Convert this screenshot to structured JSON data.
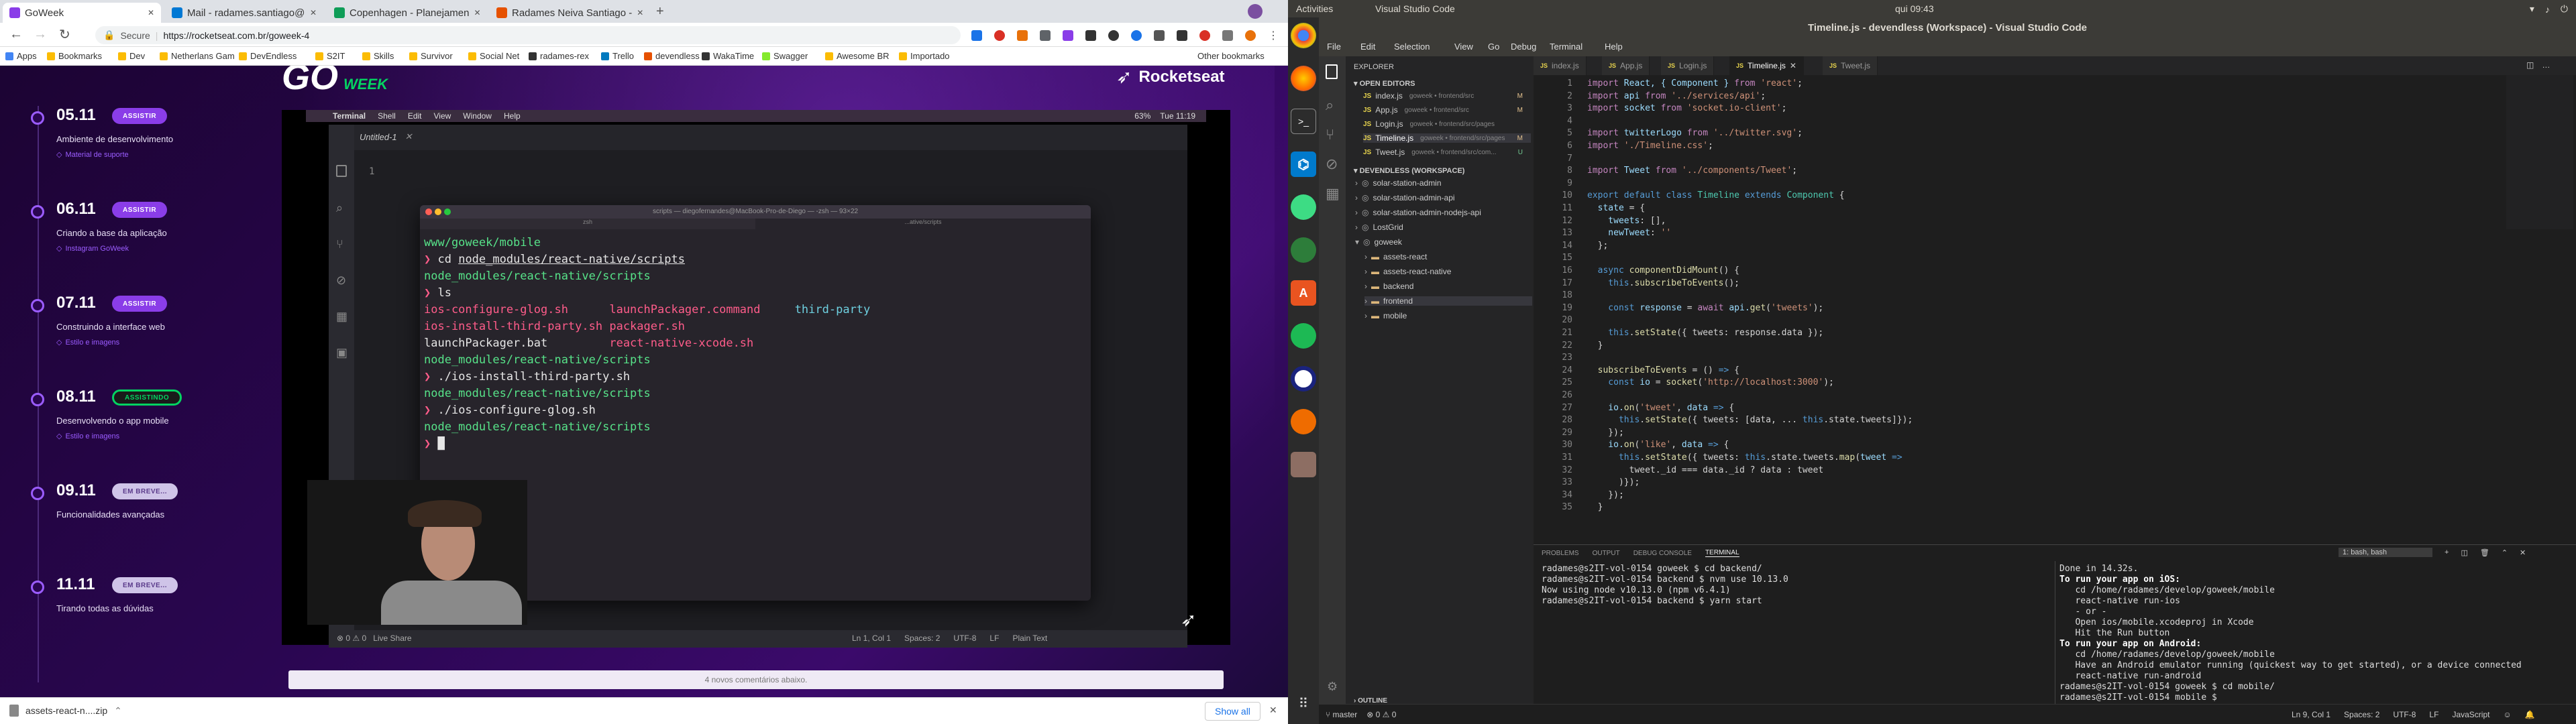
{
  "browser": {
    "tabs": [
      {
        "title": "GoWeek",
        "color": "#8a3de8",
        "active": true
      },
      {
        "title": "Mail - radames.santiago@",
        "color": "#0078d4"
      },
      {
        "title": "Copenhagen - Planejamen",
        "color": "#0f9d58"
      },
      {
        "title": "Radames Neiva Santiago -",
        "color": "#e65100"
      }
    ],
    "secure_label": "Secure",
    "url": "https://rocketseat.com.br/goweek-4",
    "bookmarks": [
      {
        "label": "Apps",
        "color": "#4285f4"
      },
      {
        "label": "Bookmarks",
        "color": "#fbbc04"
      },
      {
        "label": "Dev",
        "color": "#fbbc04"
      },
      {
        "label": "Netherlans Gam",
        "color": "#fbbc04"
      },
      {
        "label": "DevEndless",
        "color": "#fbbc04"
      },
      {
        "label": "S2IT",
        "color": "#fbbc04"
      },
      {
        "label": "Skills",
        "color": "#fbbc04"
      },
      {
        "label": "Survivor",
        "color": "#fbbc04"
      },
      {
        "label": "Social Net",
        "color": "#fbbc04"
      },
      {
        "label": "radames-rex",
        "color": "#333"
      },
      {
        "label": "Trello",
        "color": "#0079bf"
      },
      {
        "label": "devendless",
        "color": "#e65100"
      },
      {
        "label": "WakaTime",
        "color": "#333"
      },
      {
        "label": "Swagger",
        "color": "#85ea2d"
      },
      {
        "label": "Awesome BR",
        "color": "#fbbc04"
      },
      {
        "label": "Importado",
        "color": "#fbbc04"
      }
    ],
    "other_bookmarks": "Other bookmarks",
    "download_file": "assets-react-n....zip",
    "show_all": "Show all"
  },
  "page": {
    "logo": "GO",
    "logo_sub": "WEEK",
    "brand": "Rocketseat",
    "timeline": [
      {
        "date": "05.11",
        "status": "ASSISTIR",
        "kind": "watch",
        "desc": "Ambiente de desenvolvimento",
        "link": "Material de suporte"
      },
      {
        "date": "06.11",
        "status": "ASSISTIR",
        "kind": "watch",
        "desc": "Criando a base da aplicação",
        "link": "Instagram GoWeek"
      },
      {
        "date": "07.11",
        "status": "ASSISTIR",
        "kind": "watch",
        "desc": "Construindo a interface web",
        "link": "Estilo e imagens"
      },
      {
        "date": "08.11",
        "status": "ASSISTINDO",
        "kind": "live",
        "desc": "Desenvolvendo o app mobile",
        "link": "Estilo e imagens"
      },
      {
        "date": "09.11",
        "status": "EM BREVE...",
        "kind": "soon",
        "desc": "Funcionalidades avançadas",
        "link": ""
      },
      {
        "date": "11.11",
        "status": "EM BREVE...",
        "kind": "soon",
        "desc": "Tirando todas as dúvidas",
        "link": ""
      }
    ],
    "comments": "4 novos comentários abaixo."
  },
  "video": {
    "menubar": [
      "Terminal",
      "Shell",
      "Edit",
      "View",
      "Window",
      "Help"
    ],
    "mac_clock": "Tue 11:19",
    "mac_battery": "63%",
    "editor_tab": "Untitled-1",
    "line_no": "1",
    "term_title": "scripts — diegofernandes@MacBook-Pro-de-Diego — -zsh — 93×22",
    "term_tab1": "zsh",
    "term_tab2": "...ative/scripts",
    "terminal_lines": [
      [
        {
          "t": "www/goweek/mobile",
          "c": "tg"
        }
      ],
      [
        {
          "t": "❯ ",
          "c": "tp"
        },
        {
          "t": "cd ",
          "c": ""
        },
        {
          "t": "node_modules/react-native/scripts",
          "c": "u"
        }
      ],
      [
        {
          "t": "node_modules/react-native/scripts",
          "c": "tg"
        }
      ],
      [
        {
          "t": "❯ ",
          "c": "tp"
        },
        {
          "t": "ls",
          "c": ""
        }
      ],
      [
        {
          "t": "ios-configure-glog.sh      ",
          "c": "tp"
        },
        {
          "t": "launchPackager.command     ",
          "c": "tp"
        },
        {
          "t": "third-party",
          "c": "tc"
        }
      ],
      [
        {
          "t": "ios-install-third-party.sh ",
          "c": "tp"
        },
        {
          "t": "packager.sh",
          "c": "tp"
        }
      ],
      [
        {
          "t": "launchPackager.bat         ",
          "c": ""
        },
        {
          "t": "react-native-xcode.sh",
          "c": "tp"
        }
      ],
      [
        {
          "t": "node_modules/react-native/scripts",
          "c": "tg"
        }
      ],
      [
        {
          "t": "❯ ",
          "c": "tp"
        },
        {
          "t": "./ios-install-third-party.sh",
          "c": ""
        }
      ],
      [
        {
          "t": "node_modules/react-native/scripts",
          "c": "tg"
        }
      ],
      [
        {
          "t": "❯ ",
          "c": "tp"
        },
        {
          "t": "./ios-configure-glog.sh",
          "c": ""
        }
      ],
      [
        {
          "t": "node_modules/react-native/scripts",
          "c": "tg"
        }
      ],
      [
        {
          "t": "❯ ",
          "c": "tp"
        },
        {
          "t": "█",
          "c": ""
        }
      ]
    ],
    "mac_status": {
      "problems": "0",
      "warnings": "0",
      "live": "Live Share",
      "pos": "Ln 1, Col 1",
      "spaces": "Spaces: 2",
      "enc": "UTF-8",
      "eol": "LF",
      "lang": "Plain Text"
    }
  },
  "ubuntu": {
    "activities": "Activities",
    "app": "Visual Studio Code",
    "clock": "qui 09:43"
  },
  "vscode": {
    "title": "Timeline.js - devendless (Workspace) - Visual Studio Code",
    "menu": [
      "File",
      "Edit",
      "Selection",
      "View",
      "Go",
      "Debug",
      "Terminal",
      "Help"
    ],
    "explorer": "EXPLORER",
    "open_editors": "OPEN EDITORS",
    "open_files": [
      {
        "name": "index.js",
        "path": "goweek • frontend/src",
        "mod": "M"
      },
      {
        "name": "App.js",
        "path": "goweek • frontend/src",
        "mod": "M"
      },
      {
        "name": "Login.js",
        "path": "goweek • frontend/src/pages",
        "mod": ""
      },
      {
        "name": "Timeline.js",
        "path": "goweek • frontend/src/pages",
        "mod": "M"
      },
      {
        "name": "Tweet.js",
        "path": "goweek • frontend/src/com...",
        "mod": "U"
      }
    ],
    "workspace": "DEVENDLESS (WORKSPACE)",
    "folders": [
      "solar-station-admin",
      "solar-station-admin-api",
      "solar-station-admin-nodejs-api",
      "LostGrid",
      "goweek",
      "assets-react",
      "assets-react-native",
      "backend",
      "frontend",
      "mobile"
    ],
    "tabs": [
      "index.js",
      "App.js",
      "Login.js",
      "Timeline.js",
      "Tweet.js"
    ],
    "active_tab": "Timeline.js",
    "code": [
      [
        {
          "t": "import ",
          "c": "kw"
        },
        {
          "t": "React, { Component } ",
          "c": "v"
        },
        {
          "t": "from ",
          "c": "kw"
        },
        {
          "t": "'react'",
          "c": "s"
        },
        {
          "t": ";",
          "c": ""
        }
      ],
      [
        {
          "t": "import ",
          "c": "kw"
        },
        {
          "t": "api ",
          "c": "v"
        },
        {
          "t": "from ",
          "c": "kw"
        },
        {
          "t": "'../services/api'",
          "c": "s"
        },
        {
          "t": ";",
          "c": ""
        }
      ],
      [
        {
          "t": "import ",
          "c": "kw"
        },
        {
          "t": "socket ",
          "c": "v"
        },
        {
          "t": "from ",
          "c": "kw"
        },
        {
          "t": "'socket.io-client'",
          "c": "s"
        },
        {
          "t": ";",
          "c": ""
        }
      ],
      [],
      [
        {
          "t": "import ",
          "c": "kw"
        },
        {
          "t": "twitterLogo ",
          "c": "v"
        },
        {
          "t": "from ",
          "c": "kw"
        },
        {
          "t": "'../twitter.svg'",
          "c": "s"
        },
        {
          "t": ";",
          "c": ""
        }
      ],
      [
        {
          "t": "import ",
          "c": "kw"
        },
        {
          "t": "'./Timeline.css'",
          "c": "s"
        },
        {
          "t": ";",
          "c": ""
        }
      ],
      [],
      [
        {
          "t": "import ",
          "c": "kw"
        },
        {
          "t": "Tweet ",
          "c": "v"
        },
        {
          "t": "from ",
          "c": "kw"
        },
        {
          "t": "'../components/Tweet'",
          "c": "s"
        },
        {
          "t": ";",
          "c": ""
        }
      ],
      [],
      [
        {
          "t": "export default class ",
          "c": "k"
        },
        {
          "t": "Timeline ",
          "c": "c"
        },
        {
          "t": "extends ",
          "c": "k"
        },
        {
          "t": "Component ",
          "c": "c"
        },
        {
          "t": "{",
          "c": ""
        }
      ],
      [
        {
          "t": "  state ",
          "c": "v"
        },
        {
          "t": "= {",
          "c": ""
        }
      ],
      [
        {
          "t": "    tweets",
          "c": "v"
        },
        {
          "t": ": [],",
          "c": ""
        }
      ],
      [
        {
          "t": "    newTweet",
          "c": "v"
        },
        {
          "t": ": ",
          "c": ""
        },
        {
          "t": "''",
          "c": "s"
        }
      ],
      [
        {
          "t": "  };",
          "c": ""
        }
      ],
      [],
      [
        {
          "t": "  async ",
          "c": "k"
        },
        {
          "t": "componentDidMount",
          "c": "f"
        },
        {
          "t": "() {",
          "c": ""
        }
      ],
      [
        {
          "t": "    this",
          "c": "k"
        },
        {
          "t": ".",
          "c": ""
        },
        {
          "t": "subscribeToEvents",
          "c": "f"
        },
        {
          "t": "();",
          "c": ""
        }
      ],
      [],
      [
        {
          "t": "    const ",
          "c": "k"
        },
        {
          "t": "response ",
          "c": "v"
        },
        {
          "t": "= ",
          "c": ""
        },
        {
          "t": "await ",
          "c": "kw"
        },
        {
          "t": "api.",
          "c": "v"
        },
        {
          "t": "get",
          "c": "f"
        },
        {
          "t": "(",
          "c": ""
        },
        {
          "t": "'tweets'",
          "c": "s"
        },
        {
          "t": ");",
          "c": ""
        }
      ],
      [],
      [
        {
          "t": "    this",
          "c": "k"
        },
        {
          "t": ".",
          "c": ""
        },
        {
          "t": "setState",
          "c": "f"
        },
        {
          "t": "({ tweets: response.data });",
          "c": ""
        }
      ],
      [
        {
          "t": "  }",
          "c": ""
        }
      ],
      [],
      [
        {
          "t": "  subscribeToEvents ",
          "c": "f"
        },
        {
          "t": "= () ",
          "c": ""
        },
        {
          "t": "=> ",
          "c": "k"
        },
        {
          "t": "{",
          "c": ""
        }
      ],
      [
        {
          "t": "    const ",
          "c": "k"
        },
        {
          "t": "io ",
          "c": "v"
        },
        {
          "t": "= ",
          "c": ""
        },
        {
          "t": "socket",
          "c": "f"
        },
        {
          "t": "(",
          "c": ""
        },
        {
          "t": "'http://localhost:3000'",
          "c": "s"
        },
        {
          "t": ");",
          "c": ""
        }
      ],
      [],
      [
        {
          "t": "    io.",
          "c": "v"
        },
        {
          "t": "on",
          "c": "f"
        },
        {
          "t": "(",
          "c": ""
        },
        {
          "t": "'tweet'",
          "c": "s"
        },
        {
          "t": ", ",
          "c": ""
        },
        {
          "t": "data ",
          "c": "v"
        },
        {
          "t": "=> ",
          "c": "k"
        },
        {
          "t": "{",
          "c": ""
        }
      ],
      [
        {
          "t": "      this",
          "c": "k"
        },
        {
          "t": ".",
          "c": ""
        },
        {
          "t": "setState",
          "c": "f"
        },
        {
          "t": "({ tweets: [data, ... ",
          "c": ""
        },
        {
          "t": "this",
          "c": "k"
        },
        {
          "t": ".state.tweets]});",
          "c": ""
        }
      ],
      [
        {
          "t": "    });",
          "c": ""
        }
      ],
      [
        {
          "t": "    io.",
          "c": "v"
        },
        {
          "t": "on",
          "c": "f"
        },
        {
          "t": "(",
          "c": ""
        },
        {
          "t": "'like'",
          "c": "s"
        },
        {
          "t": ", ",
          "c": ""
        },
        {
          "t": "data ",
          "c": "v"
        },
        {
          "t": "=> ",
          "c": "k"
        },
        {
          "t": "{",
          "c": ""
        }
      ],
      [
        {
          "t": "      this",
          "c": "k"
        },
        {
          "t": ".",
          "c": ""
        },
        {
          "t": "setState",
          "c": "f"
        },
        {
          "t": "({ tweets: ",
          "c": ""
        },
        {
          "t": "this",
          "c": "k"
        },
        {
          "t": ".state.tweets.",
          "c": ""
        },
        {
          "t": "map",
          "c": "f"
        },
        {
          "t": "(",
          "c": ""
        },
        {
          "t": "tweet ",
          "c": "v"
        },
        {
          "t": "=>",
          "c": "k"
        }
      ],
      [
        {
          "t": "        tweet._id === data._id ? data : tweet",
          "c": ""
        }
      ],
      [
        {
          "t": "      )});",
          "c": ""
        }
      ],
      [
        {
          "t": "    });",
          "c": ""
        }
      ],
      [
        {
          "t": "  }",
          "c": ""
        }
      ]
    ],
    "panel_tabs": [
      "PROBLEMS",
      "OUTPUT",
      "DEBUG CONSOLE",
      "TERMINAL"
    ],
    "active_panel": "TERMINAL",
    "terminal_select": "1: bash, bash",
    "term_left": [
      "radames@s2IT-vol-0154 goweek $ cd backend/",
      "radames@s2IT-vol-0154 backend $ nvm use 10.13.0",
      "Now using node v10.13.0 (npm v6.4.1)",
      "radames@s2IT-vol-0154 backend $ yarn start"
    ],
    "term_right": [
      "Done in 14.32s.",
      "To run your app on iOS:",
      "   cd /home/radames/develop/goweek/mobile",
      "   react-native run-ios",
      "   - or -",
      "   Open ios/mobile.xcodeproj in Xcode",
      "   Hit the Run button",
      "To run your app on Android:",
      "   cd /home/radames/develop/goweek/mobile",
      "   Have an Android emulator running (quickest way to get started), or a device connected",
      "   react-native run-android",
      "radames@s2IT-vol-0154 goweek $ cd mobile/",
      "radames@s2IT-vol-0154 mobile $ "
    ],
    "outline": "OUTLINE",
    "status": {
      "branch": "master",
      "errors": "0",
      "warnings": "0",
      "pos": "Ln 9, Col 1",
      "spaces": "Spaces: 2",
      "enc": "UTF-8",
      "eol": "LF",
      "lang": "JavaScript"
    }
  }
}
